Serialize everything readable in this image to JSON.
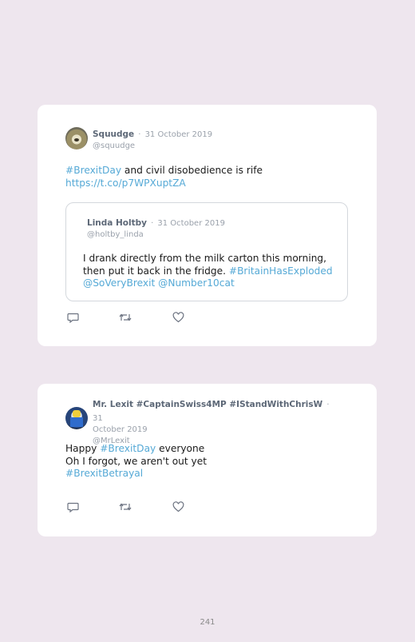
{
  "tweets": [
    {
      "author": {
        "name": "Squudge",
        "handle": "@squudge",
        "date": "31 October 2019",
        "separator": "·"
      },
      "text": {
        "hashtag": "#BrexitDay",
        "body": " and civil disobedience is rife",
        "link": "https://t.co/p7WPXuptZA"
      },
      "quote": {
        "author": {
          "name": "Linda Holtby",
          "handle": "@holtby_linda",
          "date": "31 October 2019",
          "separator": "·"
        },
        "line1": "I drank directly from the milk carton this morning,",
        "line2_text": "then put it back in the fridge. ",
        "line2_tag": "#BritainHasExploded",
        "line3_mention1": "@SoVeryBrexit",
        "line3_space": " ",
        "line3_mention2": "@Number10cat"
      },
      "actions": [
        "reply-icon",
        "retweet-icon",
        "like-icon"
      ]
    },
    {
      "author": {
        "name": "Mr. Lexit #CaptainSwiss4MP #IStandWithChrisW",
        "separator": "·",
        "date_part1": "31",
        "date_part2": "October 2019",
        "handle": "@MrLexit"
      },
      "text": {
        "line1_text": "Happy ",
        "line1_tag": "#BrexitDay",
        "line1_end": " everyone",
        "line2": "Oh I forgot, we aren't out yet",
        "line3_tag": "#BrexitBetrayal"
      },
      "actions": [
        "reply-icon",
        "retweet-icon",
        "like-icon"
      ]
    }
  ],
  "page_number": "241",
  "colors": {
    "background": "#eee6ee",
    "card": "#ffffff",
    "link": "#55a9d6",
    "muted": "#9aa1ab",
    "name": "#5d6877"
  }
}
